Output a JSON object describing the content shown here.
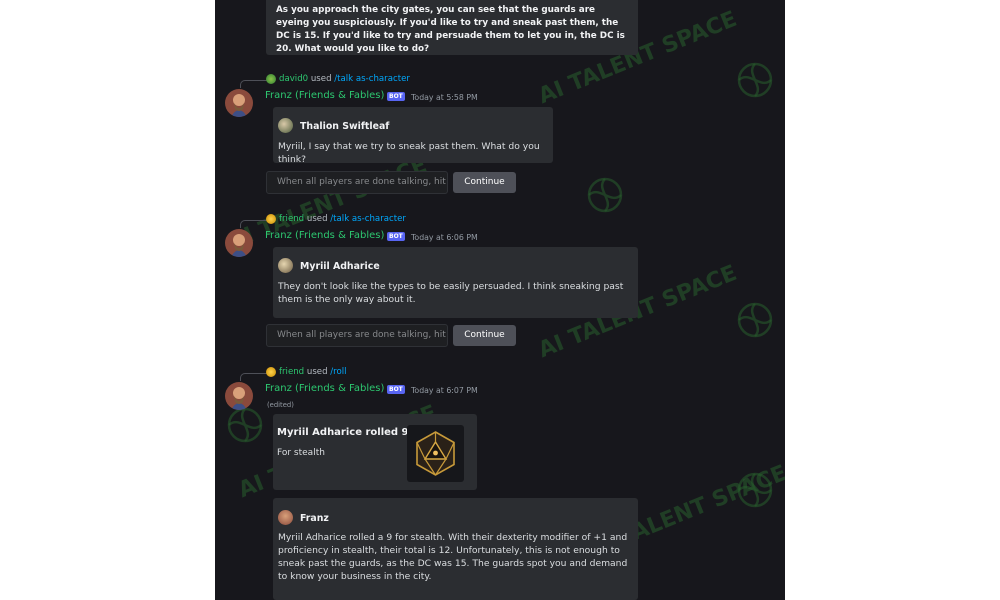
{
  "top_embed": {
    "text": "As you approach the city gates, you can see that the guards are eyeing you suspiciously. If you'd like to try and sneak past them, the DC is 15. If you'd like to try and persuade them to let you in, the DC is 20. What would you like to do?"
  },
  "messages": [
    {
      "reply_user": "david0",
      "reply_used": "used",
      "reply_command": "/talk as-character",
      "author": "Franz (Friends & Fables)",
      "badge": "BOT",
      "time": "Today at 5:58 PM",
      "embed_title": "Thalion Swiftleaf",
      "embed_text": "Myriil, I say that we try to sneak past them. What do you think?",
      "field_placeholder": "When all players are done talking, hit",
      "button_label": "Continue"
    },
    {
      "reply_user": "friend",
      "reply_used": "used",
      "reply_command": "/talk as-character",
      "author": "Franz (Friends & Fables)",
      "badge": "BOT",
      "time": "Today at 6:06 PM",
      "embed_title": "Myriil Adharice",
      "embed_text": "They don't look like the types to be easily persuaded. I think sneaking past them is the only way about it.",
      "field_placeholder": "When all players are done talking, hit",
      "button_label": "Continue"
    },
    {
      "reply_user": "friend",
      "reply_used": "used",
      "reply_command": "/roll",
      "author": "Franz (Friends & Fables)",
      "badge": "BOT",
      "time": "Today at 6:07 PM",
      "edited": "(edited)",
      "roll_title": "Myriil Adharice rolled 9!",
      "roll_subtitle": "For stealth",
      "franz_name": "Franz",
      "franz_text": "Myriil Adharice rolled a 9 for stealth. With their dexterity modifier of +1 and proficiency in stealth, their total is 12. Unfortunately, this is not enough to sneak past the guards, as the DC was 15. The guards spot you and demand to know your business in the city."
    }
  ],
  "watermark": "AI TALENT SPACE",
  "colors": {
    "background": "#17171c",
    "embed": "#2b2d31",
    "author": "#2dc770",
    "command": "#00a8fc",
    "badge": "#5865f2"
  }
}
